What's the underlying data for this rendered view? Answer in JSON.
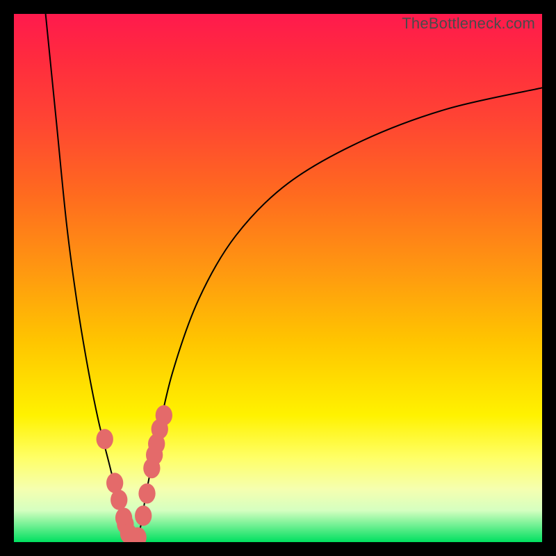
{
  "watermark": "TheBottleneck.com",
  "chart_data": {
    "type": "line",
    "title": "",
    "xlabel": "",
    "ylabel": "",
    "xlim": [
      0,
      100
    ],
    "ylim": [
      0,
      100
    ],
    "background": {
      "top_color": "#ff1a4d",
      "bottom_color": "#00e060",
      "description": "vertical warm-to-green gradient (red→orange→yellow→green)"
    },
    "series": [
      {
        "name": "left-curve",
        "color": "#000000",
        "x": [
          6,
          8,
          10,
          12,
          14,
          16,
          18,
          19,
          20,
          21,
          22,
          23
        ],
        "y": [
          100,
          80,
          60,
          45,
          33,
          23,
          15,
          11,
          7,
          4,
          2,
          0
        ]
      },
      {
        "name": "right-curve",
        "color": "#000000",
        "x": [
          23,
          24,
          25,
          27,
          30,
          35,
          42,
          52,
          66,
          82,
          100
        ],
        "y": [
          0,
          3,
          9,
          19,
          32,
          46,
          58,
          68,
          76,
          82,
          86
        ]
      },
      {
        "name": "left-beads",
        "color": "#e46a6a",
        "type": "scatter",
        "x": [
          17.2,
          19.1,
          19.9,
          20.8,
          21.1,
          21.7,
          22.6
        ],
        "y": [
          19.5,
          11.2,
          8.0,
          4.6,
          3.4,
          1.6,
          0.6
        ]
      },
      {
        "name": "right-beads",
        "color": "#e46a6a",
        "type": "scatter",
        "x": [
          23.5,
          24.5,
          25.2,
          26.1,
          26.6,
          27.0,
          27.6,
          28.4
        ],
        "y": [
          0.9,
          5.0,
          9.2,
          14.0,
          16.5,
          18.6,
          21.4,
          24.0
        ]
      }
    ],
    "valley_x": 23,
    "bead_radius": 1.6
  }
}
